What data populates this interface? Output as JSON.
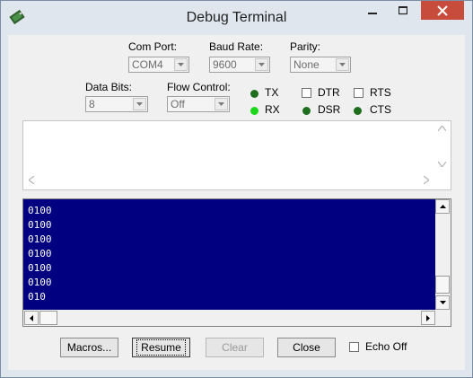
{
  "window": {
    "title": "Debug Terminal"
  },
  "settings": {
    "com_port": {
      "label": "Com Port:",
      "value": "COM4"
    },
    "baud_rate": {
      "label": "Baud Rate:",
      "value": "9600"
    },
    "parity": {
      "label": "Parity:",
      "value": "None"
    },
    "data_bits": {
      "label": "Data Bits:",
      "value": "8"
    },
    "flow_control": {
      "label": "Flow Control:",
      "value": "Off"
    }
  },
  "indicators": {
    "tx": "TX",
    "rx": "RX",
    "dtr": "DTR",
    "rts": "RTS",
    "dsr": "DSR",
    "cts": "CTS",
    "colors": {
      "tx": "#1e6e1e",
      "rx": "#1bd61b",
      "dsr": "#1e6e1e",
      "cts": "#1e6e1e"
    }
  },
  "terminal": {
    "background": "#000080",
    "lines": [
      "0100",
      "0100",
      "0100",
      "0100",
      "0100",
      "0100",
      "010"
    ]
  },
  "buttons": {
    "macros": "Macros...",
    "resume": "Resume",
    "clear": "Clear",
    "close": "Close",
    "echo_off": "Echo Off"
  }
}
